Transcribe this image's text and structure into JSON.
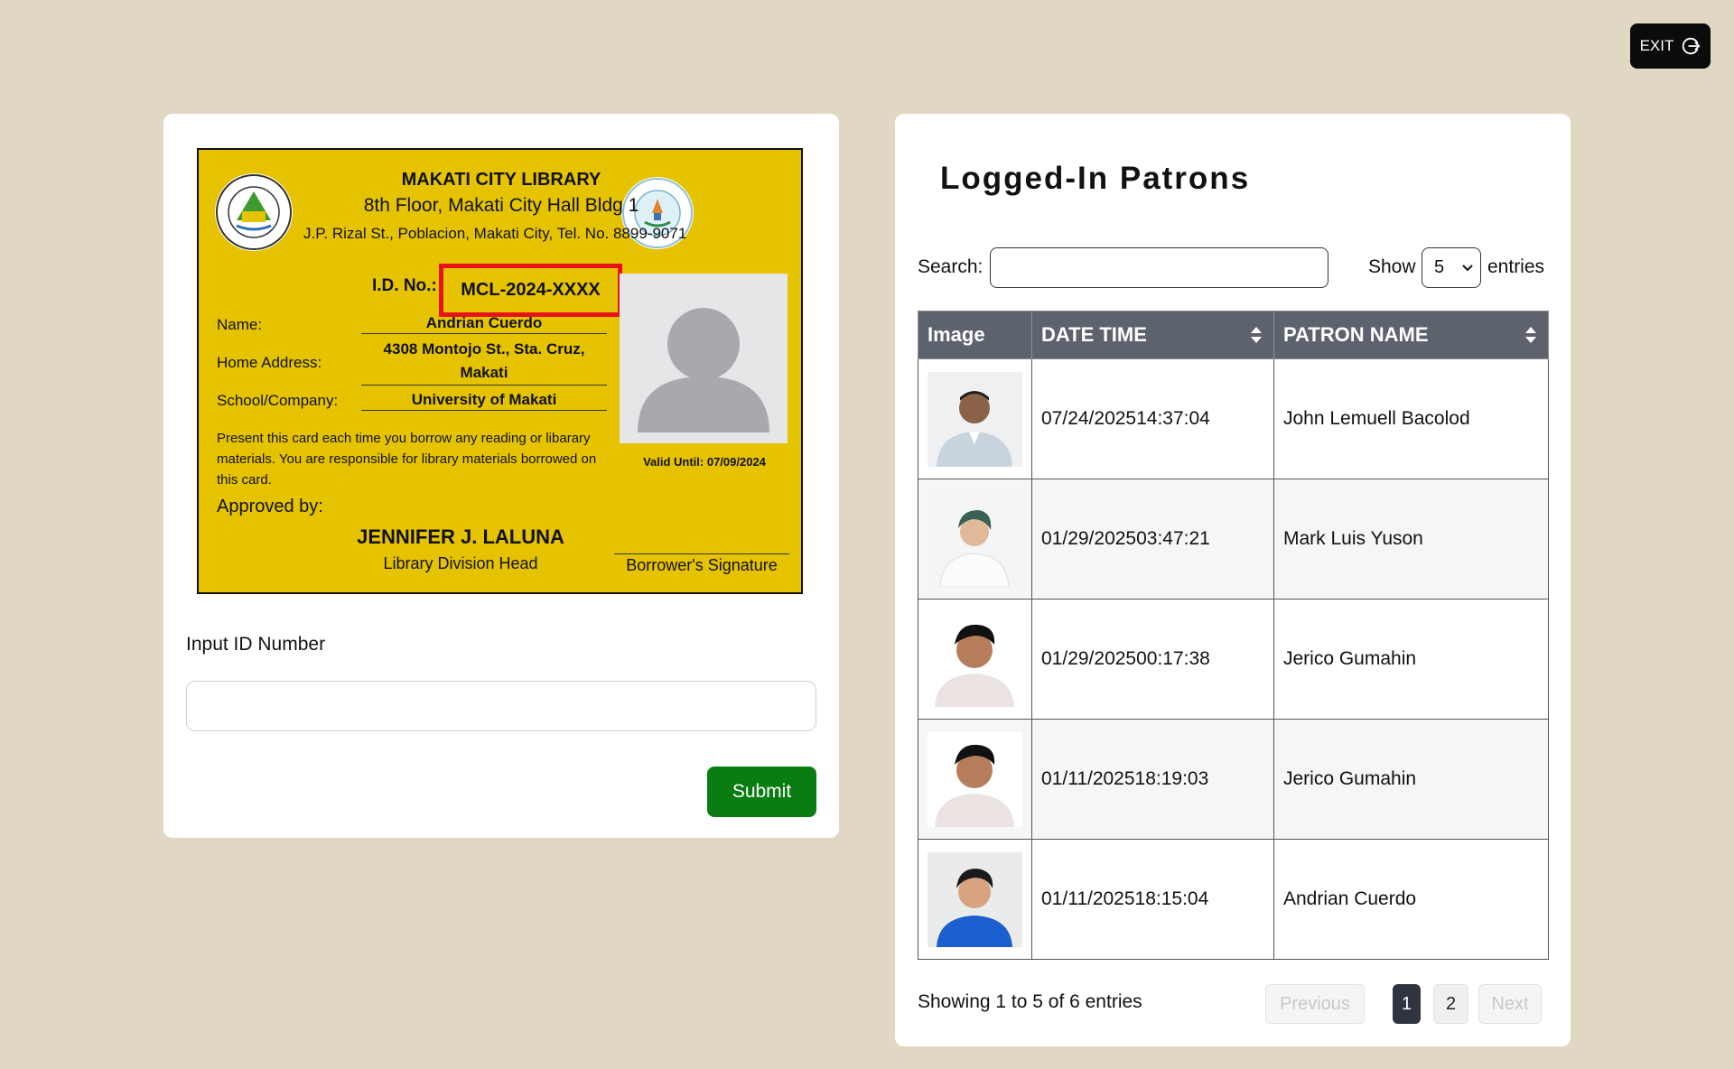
{
  "header": {
    "exit_label": "EXIT"
  },
  "id_card": {
    "library_name": "MAKATI CITY LIBRARY",
    "address_line1": "8th Floor, Makati City Hall Bldg 1",
    "address_line2": "J.P. Rizal St., Poblacion, Makati City, Tel. No. 8899-9071",
    "idno_label": "I.D. No.:",
    "idno_value": "MCL-2024-XXXX",
    "name_label": "Name:",
    "name_value": "Andrian Cuerdo",
    "address_label": "Home Address:",
    "address_value": "4308 Montojo St., Sta. Cruz, Makati",
    "school_label": "School/Company:",
    "school_value": "University of Makati",
    "notice": "Present this card each time you borrow any reading or libarary materials. You are responsible for library materials borrowed on this card.",
    "valid_until": "Valid Until: 07/09/2024",
    "approved_by": "Approved by:",
    "signer_name": "JENNIFER J. LALUNA",
    "signer_role": "Library Division Head",
    "signature_label": "Borrower's Signature"
  },
  "form": {
    "input_label": "Input ID Number",
    "input_value": "",
    "submit_label": "Submit"
  },
  "patrons": {
    "title": "Logged-In Patrons",
    "search_label": "Search:",
    "search_value": "",
    "show_label": "Show",
    "show_value": "5",
    "entries_label": "entries",
    "columns": [
      "Image",
      "DATE TIME",
      "PATRON NAME"
    ],
    "rows": [
      {
        "datetime": "07/24/202514:37:04",
        "name": "John Lemuell Bacolod",
        "photo": "person-photo-1"
      },
      {
        "datetime": "01/29/202503:47:21",
        "name": "Mark Luis Yuson",
        "photo": "person-photo-2"
      },
      {
        "datetime": "01/29/202500:17:38",
        "name": "Jerico Gumahin",
        "photo": "person-photo-3"
      },
      {
        "datetime": "01/11/202518:19:03",
        "name": "Jerico Gumahin",
        "photo": "person-photo-4"
      },
      {
        "datetime": "01/11/202518:15:04",
        "name": "Andrian Cuerdo",
        "photo": "person-photo-5"
      }
    ],
    "showing_text": "Showing 1 to 5 of 6 entries",
    "pagination": {
      "previous": "Previous",
      "page1": "1",
      "page2": "2",
      "next": "Next"
    }
  },
  "colors": {
    "background": "#e0d8c2",
    "card_yellow": "#e6c300",
    "highlight_red": "#e8121a",
    "submit_green": "#0a7d12",
    "table_header": "#5c636d"
  }
}
